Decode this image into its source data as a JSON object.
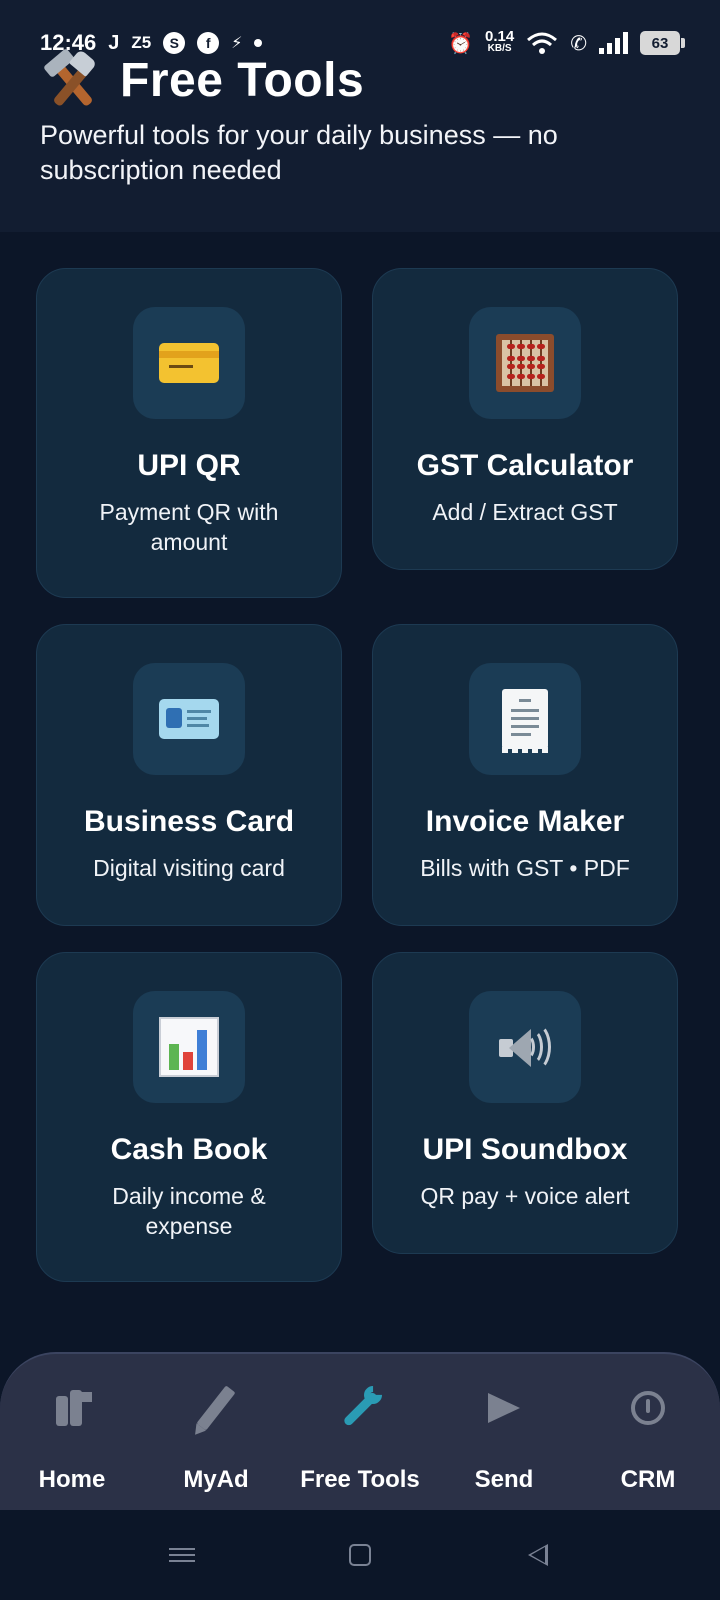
{
  "status_bar": {
    "time": "12:46",
    "left_glyphs": [
      "J",
      "Z5",
      "S",
      "f",
      "⚡"
    ],
    "net_speed_value": "0.14",
    "net_speed_unit": "KB/S",
    "battery": "63"
  },
  "header": {
    "title": "Free Tools",
    "subtitle": "Powerful tools for your daily business — no subscription needed",
    "icon": "hammer-and-wrench-icon"
  },
  "tools": [
    {
      "id": "upi-qr",
      "title": "UPI QR",
      "description": "Payment QR with amount",
      "icon": "credit-card-icon"
    },
    {
      "id": "gst-calculator",
      "title": "GST Calculator",
      "description": "Add / Extract GST",
      "icon": "abacus-icon"
    },
    {
      "id": "business-card",
      "title": "Business Card",
      "description": "Digital visiting card",
      "icon": "id-card-icon"
    },
    {
      "id": "invoice-maker",
      "title": "Invoice Maker",
      "description": "Bills with GST • PDF",
      "icon": "receipt-icon"
    },
    {
      "id": "cash-book",
      "title": "Cash Book",
      "description": "Daily income & expense",
      "icon": "bar-chart-icon"
    },
    {
      "id": "upi-soundbox",
      "title": "UPI Soundbox",
      "description": "QR pay + voice alert",
      "icon": "speaker-icon"
    }
  ],
  "bottom_nav": {
    "active": "Free Tools",
    "active_color": "#2a9bb4",
    "items": [
      {
        "label": "Home",
        "icon": "home-people-icon"
      },
      {
        "label": "MyAd",
        "icon": "pencil-icon"
      },
      {
        "label": "Free Tools",
        "icon": "wrench-icon"
      },
      {
        "label": "Send",
        "icon": "send-icon"
      },
      {
        "label": "CRM",
        "icon": "power-icon"
      }
    ]
  },
  "colors": {
    "background": "#0c1628",
    "header_background": "#121d31",
    "card_background": "#132a3e",
    "icon_tile": "#1b3c55",
    "nav_background": "#2b3147"
  }
}
